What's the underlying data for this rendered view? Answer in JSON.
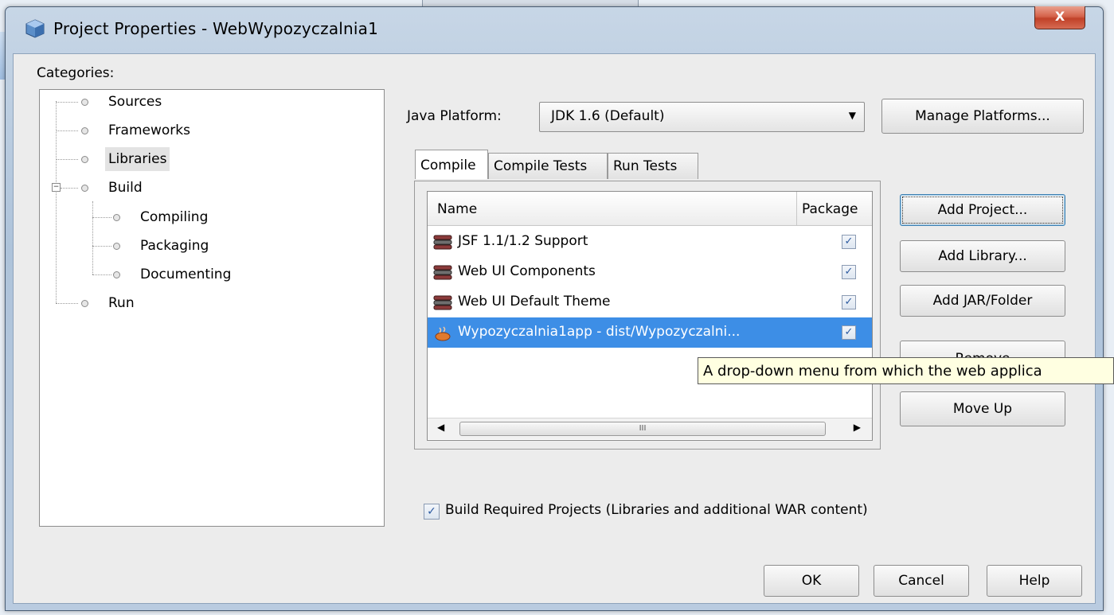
{
  "window": {
    "title": "Project Properties - WebWypozyczalnia1",
    "close_label": "X"
  },
  "categories": {
    "label": "Categories:",
    "items": [
      {
        "label": "Sources",
        "level": 0
      },
      {
        "label": "Frameworks",
        "level": 0
      },
      {
        "label": "Libraries",
        "level": 0,
        "selected": true
      },
      {
        "label": "Build",
        "level": 0,
        "expanded": true
      },
      {
        "label": "Compiling",
        "level": 1
      },
      {
        "label": "Packaging",
        "level": 1
      },
      {
        "label": "Documenting",
        "level": 1
      },
      {
        "label": "Run",
        "level": 0
      }
    ]
  },
  "platform": {
    "label": "Java Platform:",
    "selected": "JDK 1.6 (Default)",
    "manage_button": "Manage Platforms..."
  },
  "tabs": [
    {
      "label": "Compile",
      "active": true
    },
    {
      "label": "Compile Tests",
      "active": false
    },
    {
      "label": "Run Tests",
      "active": false
    }
  ],
  "table": {
    "columns": [
      "Name",
      "Package"
    ],
    "rows": [
      {
        "name": "JSF 1.1/1.2 Support",
        "icon": "library-icon",
        "checked": true
      },
      {
        "name": "Web UI Components",
        "icon": "library-icon",
        "checked": true
      },
      {
        "name": "Web UI Default Theme",
        "icon": "library-icon",
        "checked": true
      },
      {
        "name": "Wypozyczalnia1app - dist/Wypozyczalni...",
        "icon": "java-project-icon",
        "checked": true,
        "selected": true
      }
    ],
    "scroll_thumb": "III"
  },
  "side_buttons": {
    "add_project": "Add Project...",
    "add_library": "Add Library...",
    "add_jar": "Add JAR/Folder",
    "remove": "Remove",
    "move_up": "Move Up"
  },
  "tooltip": "A drop-down menu from which the web applica",
  "build_required": {
    "label": "Build Required Projects (Libraries and additional WAR content)",
    "checked": true
  },
  "footer": {
    "ok": "OK",
    "cancel": "Cancel",
    "help": "Help"
  },
  "colors": {
    "selection": "#3d8ee6",
    "tooltip_bg": "#ffffe1",
    "close_button": "#c94a30"
  }
}
